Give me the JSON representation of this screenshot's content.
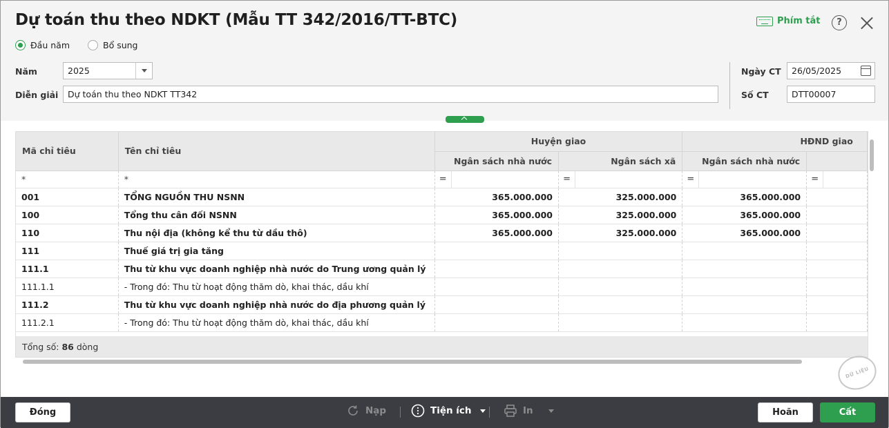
{
  "window": {
    "title": "Dự toán thu theo NDKT (Mẫu TT 342/2016/TT-BTC)",
    "shortcut_label": "Phím tắt",
    "help_glyph": "?"
  },
  "radios": [
    {
      "label": "Đầu năm",
      "selected": true
    },
    {
      "label": "Bổ sung",
      "selected": false
    }
  ],
  "form": {
    "year_label": "Năm",
    "year_value": "2025",
    "desc_label": "Diễn giải",
    "desc_value": "Dự toán thu theo NDKT TT342",
    "date_label": "Ngày CT",
    "date_value": "26/05/2025",
    "doc_label": "Số CT",
    "doc_value": "DTT00007"
  },
  "grid": {
    "headers": {
      "code": "Mã chỉ tiêu",
      "name": "Tên chỉ tiêu",
      "group1": "Huyện giao",
      "group2": "HĐND giao",
      "g1_col1": "Ngân sách nhà nước",
      "g1_col2": "Ngân sách xã",
      "g2_col1": "Ngân sách nhà nước"
    },
    "filter": {
      "text_op": "*",
      "num_op": "="
    },
    "rows": [
      {
        "code": "001",
        "name": "TỔNG NGUỒN THU NSNN",
        "v1": "365.000.000",
        "v2": "325.000.000",
        "v3": "365.000.000",
        "bold": true
      },
      {
        "code": "100",
        "name": "Tổng thu cân đối NSNN",
        "v1": "365.000.000",
        "v2": "325.000.000",
        "v3": "365.000.000",
        "bold": true
      },
      {
        "code": "110",
        "name": "Thu nội địa (không kể thu từ dầu thô)",
        "v1": "365.000.000",
        "v2": "325.000.000",
        "v3": "365.000.000",
        "bold": true
      },
      {
        "code": "111",
        "name": "Thuế giá trị gia tăng",
        "v1": "",
        "v2": "",
        "v3": "",
        "bold": true
      },
      {
        "code": "111.1",
        "name": "Thu từ khu vực doanh nghiệp nhà nước do Trung ương quản lý",
        "v1": "",
        "v2": "",
        "v3": "",
        "bold": true
      },
      {
        "code": "111.1.1",
        "name": "- Trong đó: Thu từ hoạt động thăm dò, khai thác, dầu khí",
        "v1": "",
        "v2": "",
        "v3": "",
        "bold": false
      },
      {
        "code": "111.2",
        "name": "Thu từ khu vực doanh nghiệp nhà nước do địa phương quản lý",
        "v1": "",
        "v2": "",
        "v3": "",
        "bold": true
      },
      {
        "code": "111.2.1",
        "name": "- Trong đó: Thu từ hoạt động thăm dò, khai thác, dầu khí",
        "v1": "",
        "v2": "",
        "v3": "",
        "bold": false
      }
    ],
    "footer": {
      "prefix": "Tổng số: ",
      "count": "86",
      "suffix": " dòng"
    }
  },
  "stamp_text": "DỮ LIỆU MẪU",
  "toolbar": {
    "close_label": "Đóng",
    "reload_label": "Nạp",
    "utility_label": "Tiện ích",
    "print_label": "In",
    "cancel_label": "Hoãn",
    "save_label": "Cất"
  },
  "colors": {
    "accent": "#2e9e4f",
    "bottom_bar": "#3b3d42"
  }
}
